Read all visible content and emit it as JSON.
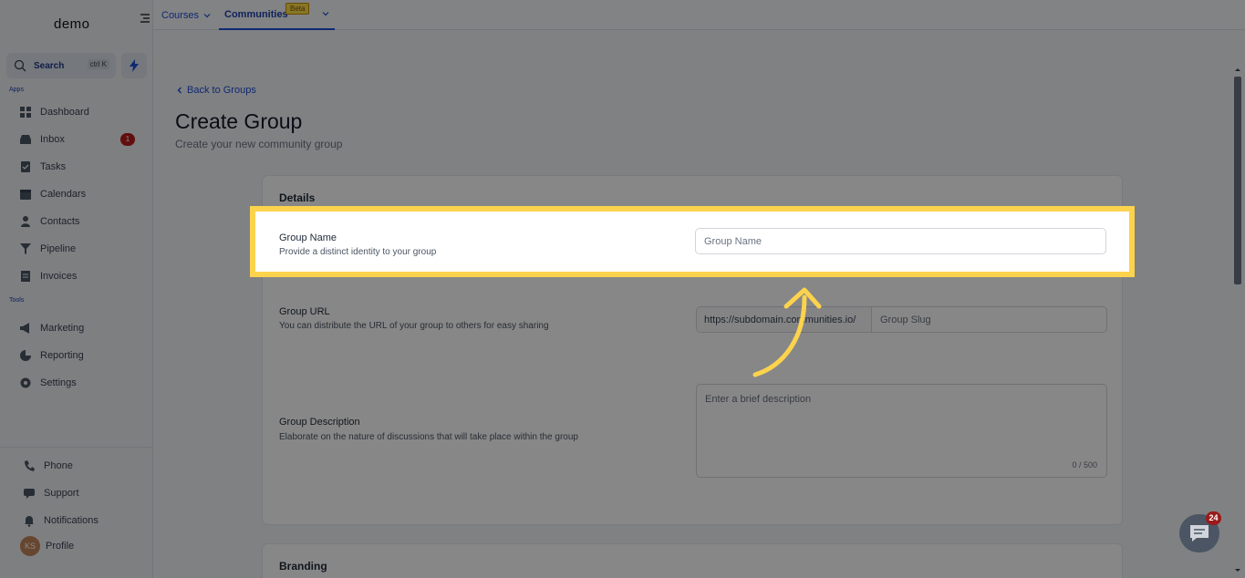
{
  "sidebar": {
    "logo": "demo",
    "search_label": "Search",
    "search_shortcut": "ctrl K",
    "apps_label": "Apps",
    "tools_label": "Tools",
    "apps": [
      {
        "label": "Dashboard",
        "icon": "dashboard-icon"
      },
      {
        "label": "Inbox",
        "icon": "inbox-icon",
        "badge": "1"
      },
      {
        "label": "Tasks",
        "icon": "tasks-icon"
      },
      {
        "label": "Calendars",
        "icon": "calendar-icon"
      },
      {
        "label": "Contacts",
        "icon": "contacts-icon"
      },
      {
        "label": "Pipeline",
        "icon": "pipeline-icon"
      },
      {
        "label": "Invoices",
        "icon": "invoices-icon"
      }
    ],
    "tools": [
      {
        "label": "Marketing",
        "icon": "megaphone-icon"
      },
      {
        "label": "Reporting",
        "icon": "reporting-icon"
      },
      {
        "label": "Settings",
        "icon": "gear-icon"
      }
    ],
    "bottom": [
      {
        "label": "Phone",
        "icon": "phone-icon"
      },
      {
        "label": "Support",
        "icon": "support-icon"
      },
      {
        "label": "Notifications",
        "icon": "bell-icon"
      },
      {
        "label": "Profile",
        "avatar": "KS"
      }
    ]
  },
  "topbar": {
    "tabs": [
      {
        "label": "Courses"
      },
      {
        "label": "Communities",
        "badge": "Beta"
      }
    ]
  },
  "main": {
    "back_label": "Back to Groups",
    "title": "Create Group",
    "subtitle": "Create your new community group",
    "details_heading": "Details",
    "group_name": {
      "label": "Group Name",
      "help": "Provide a distinct identity to your group",
      "placeholder": "Group Name"
    },
    "group_url": {
      "label": "Group URL",
      "help": "You can distribute the URL of your group to others for easy sharing",
      "prefix": "https://subdomain.communities.io/",
      "placeholder": "Group Slug"
    },
    "group_description": {
      "label": "Group Description",
      "help": "Elaborate on the nature of discussions that will take place within the group",
      "placeholder": "Enter a brief description",
      "counter": "0 / 500"
    },
    "branding_heading": "Branding"
  },
  "chat": {
    "badge": "24"
  },
  "colors": {
    "highlight": "#fcd34d",
    "accent": "#1d4ed8",
    "badge_red": "#b91c1c"
  }
}
